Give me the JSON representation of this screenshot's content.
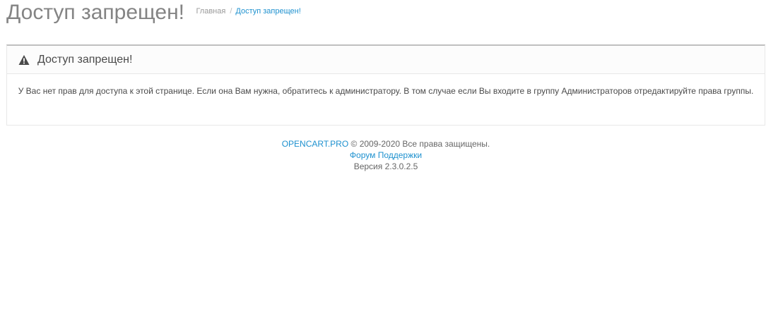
{
  "header": {
    "title": "Доступ запрещен!",
    "breadcrumb": {
      "home": "Главная",
      "separator": "/",
      "current": "Доступ запрещен!"
    }
  },
  "panel": {
    "icon": "warning-icon",
    "title": "Доступ запрещен!",
    "message": "У Вас нет прав для доступа к этой странице. Если она Вам нужна, обратитесь к администратору. В том случае если Вы входите в группу Администраторов отредактируйте права группы."
  },
  "footer": {
    "brand_link": "OPENCART.PRO",
    "copyright": "© 2009-2020 Все права защищены.",
    "support_link": "Форум Поддержки",
    "version": "Версия 2.3.0.2.5"
  },
  "colors": {
    "link": "#1e91cf",
    "title": "#848484",
    "panel_border": "#bfbfbf"
  }
}
